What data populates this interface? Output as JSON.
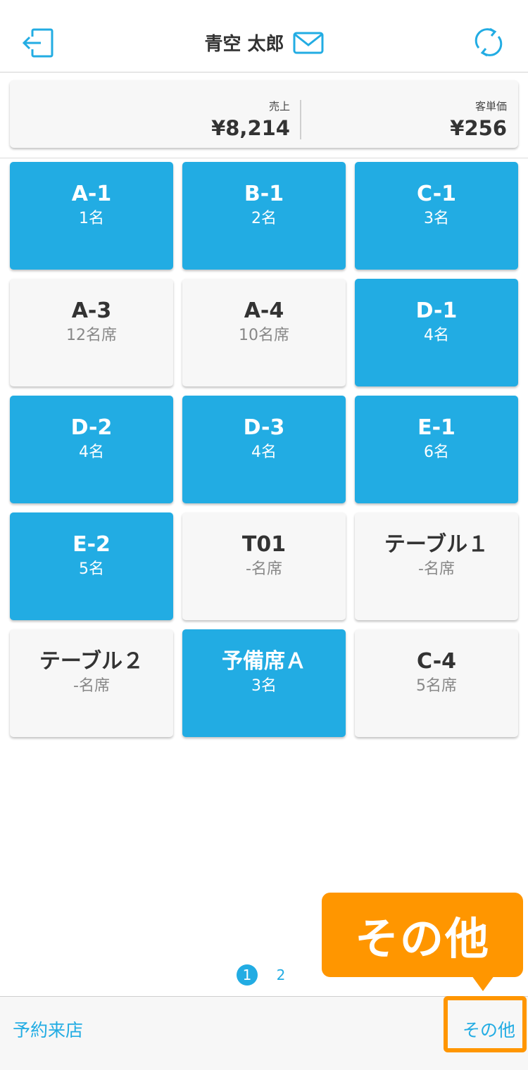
{
  "header": {
    "user_name": "青空 太郎",
    "logout_icon": "logout-icon",
    "mail_icon": "mail-icon",
    "refresh_icon": "refresh-icon",
    "accent_color": "#22ace3"
  },
  "summary": {
    "sales_label": "売上",
    "sales_value": "¥8,214",
    "avg_label": "客単価",
    "avg_value": "¥256"
  },
  "tables": [
    {
      "name": "A-1",
      "count": "1名",
      "status": "occupied"
    },
    {
      "name": "B-1",
      "count": "2名",
      "status": "occupied"
    },
    {
      "name": "C-1",
      "count": "3名",
      "status": "occupied"
    },
    {
      "name": "A-3",
      "count": "12名席",
      "status": "vacant"
    },
    {
      "name": "A-4",
      "count": "10名席",
      "status": "vacant"
    },
    {
      "name": "D-1",
      "count": "4名",
      "status": "occupied"
    },
    {
      "name": "D-2",
      "count": "4名",
      "status": "occupied"
    },
    {
      "name": "D-3",
      "count": "4名",
      "status": "occupied"
    },
    {
      "name": "E-1",
      "count": "6名",
      "status": "occupied"
    },
    {
      "name": "E-2",
      "count": "5名",
      "status": "occupied"
    },
    {
      "name": "T01",
      "count": "-名席",
      "status": "vacant"
    },
    {
      "name": "テーブル１",
      "count": "-名席",
      "status": "vacant"
    },
    {
      "name": "テーブル２",
      "count": "-名席",
      "status": "vacant"
    },
    {
      "name": "予備席Ａ",
      "count": "3名",
      "status": "occupied"
    },
    {
      "name": "C-4",
      "count": "5名席",
      "status": "vacant"
    }
  ],
  "pagination": {
    "pages": [
      "1",
      "2"
    ],
    "current": "1"
  },
  "footer": {
    "reserve_label": "予約来店",
    "other_label": "その他"
  },
  "annotation": {
    "callout_text": "その他",
    "color": "#ff9600"
  }
}
